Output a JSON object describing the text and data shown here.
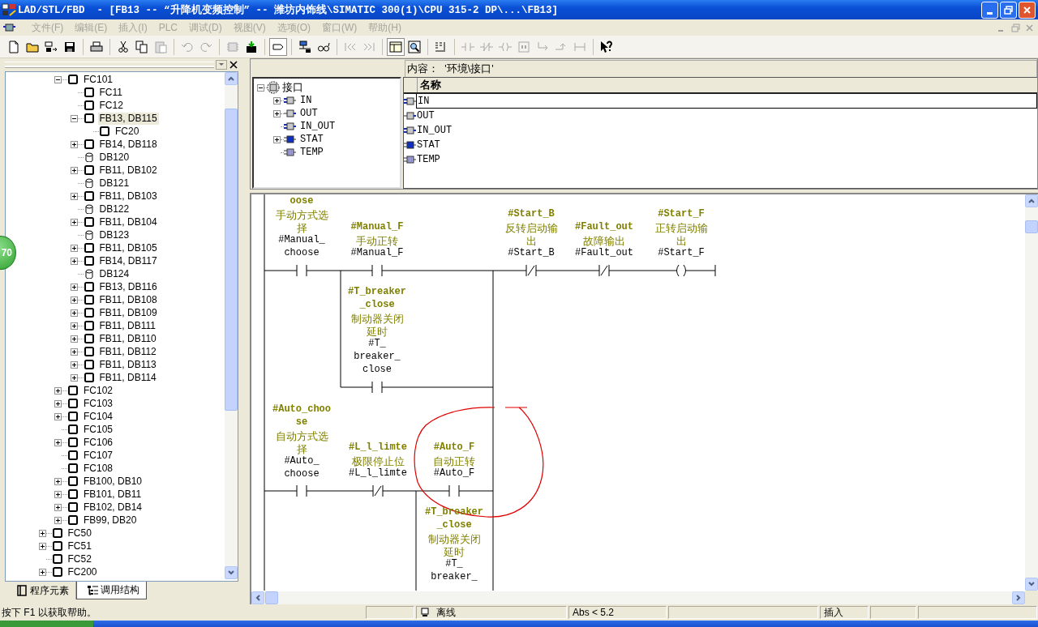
{
  "window": {
    "title": "LAD/STL/FBD  - [FB13 -- “升降机变频控制” -- 潍坊内饰线\\SIMATIC 300(1)\\CPU 315-2 DP\\...\\FB13]"
  },
  "menu": [
    {
      "label": "文件(F)",
      "disabled": true
    },
    {
      "label": "编辑(E)",
      "disabled": true
    },
    {
      "label": "插入(I)",
      "disabled": true
    },
    {
      "label": "PLC",
      "disabled": true
    },
    {
      "label": "调试(D)",
      "disabled": true
    },
    {
      "label": "视图(V)",
      "disabled": true
    },
    {
      "label": "选项(O)",
      "disabled": true
    },
    {
      "label": "窗口(W)",
      "disabled": true
    },
    {
      "label": "帮助(H)",
      "disabled": true
    }
  ],
  "toolbar": {
    "groups": [
      {
        "buttons": [
          {
            "kind": "new",
            "disabled": false,
            "pressed": false
          },
          {
            "kind": "open",
            "disabled": false,
            "pressed": false
          },
          {
            "kind": "nodes",
            "disabled": false,
            "pressed": false
          },
          {
            "kind": "save",
            "disabled": false,
            "pressed": false
          }
        ]
      },
      {
        "buttons": [
          {
            "kind": "print",
            "disabled": false,
            "pressed": false
          }
        ]
      },
      {
        "buttons": [
          {
            "kind": "cut",
            "disabled": false,
            "pressed": false
          },
          {
            "kind": "copy",
            "disabled": false,
            "pressed": false
          },
          {
            "kind": "paste",
            "disabled": true,
            "pressed": false
          }
        ]
      },
      {
        "buttons": [
          {
            "kind": "undo",
            "disabled": true,
            "pressed": false
          },
          {
            "kind": "redo",
            "disabled": true,
            "pressed": false
          }
        ]
      },
      {
        "buttons": [
          {
            "kind": "module",
            "disabled": true,
            "pressed": false
          },
          {
            "kind": "download",
            "disabled": false,
            "pressed": false
          }
        ]
      },
      {
        "buttons": [
          {
            "kind": "tag",
            "disabled": false,
            "pressed": true
          }
        ]
      },
      {
        "buttons": [
          {
            "kind": "network",
            "disabled": false,
            "pressed": false
          },
          {
            "kind": "glasses",
            "disabled": false,
            "pressed": false
          }
        ]
      },
      {
        "buttons": [
          {
            "kind": "previous",
            "disabled": true,
            "pressed": false
          },
          {
            "kind": "next",
            "disabled": true,
            "pressed": false
          }
        ]
      },
      {
        "buttons": [
          {
            "kind": "overview",
            "disabled": false,
            "pressed": true
          },
          {
            "kind": "zoom",
            "disabled": false,
            "pressed": false
          }
        ]
      },
      {
        "buttons": [
          {
            "kind": "rung",
            "disabled": false,
            "pressed": false
          }
        ]
      },
      {
        "buttons": [
          {
            "kind": "contact",
            "disabled": true,
            "pressed": false
          },
          {
            "kind": "nc_contact",
            "disabled": true,
            "pressed": false
          },
          {
            "kind": "coil",
            "disabled": true,
            "pressed": false
          },
          {
            "kind": "empty_box",
            "disabled": true,
            "pressed": false
          },
          {
            "kind": "branch_open",
            "disabled": true,
            "pressed": false
          },
          {
            "kind": "branch_close",
            "disabled": true,
            "pressed": false
          },
          {
            "kind": "connector",
            "disabled": true,
            "pressed": false
          }
        ]
      },
      {
        "buttons": [
          {
            "kind": "help",
            "disabled": false,
            "pressed": false
          }
        ]
      }
    ]
  },
  "floating_badge": {
    "text": "70"
  },
  "tree": {
    "items": [
      {
        "children": [
          {
            "label": "FC101",
            "kind": "block",
            "expanded": true,
            "selected": false,
            "children": [
              {
                "label": "FC11",
                "kind": "block",
                "selected": false
              },
              {
                "label": "FC12",
                "kind": "block",
                "selected": false
              },
              {
                "label": "FB13, DB115",
                "kind": "block",
                "expanded": true,
                "selected": true,
                "children": [
                  {
                    "label": "FC20",
                    "kind": "block",
                    "selected": false
                  }
                ]
              },
              {
                "label": "FB14, DB118",
                "kind": "block",
                "expanded": false,
                "selected": false
              },
              {
                "label": "DB120",
                "kind": "db",
                "selected": false
              },
              {
                "label": "FB11, DB102",
                "kind": "block",
                "expanded": false,
                "selected": false
              },
              {
                "label": "DB121",
                "kind": "db",
                "selected": false
              },
              {
                "label": "FB11, DB103",
                "kind": "block",
                "expanded": false,
                "selected": false
              },
              {
                "label": "DB122",
                "kind": "db",
                "selected": false
              },
              {
                "label": "FB11, DB104",
                "kind": "block",
                "expanded": false,
                "selected": false
              },
              {
                "label": "DB123",
                "kind": "db",
                "selected": false
              },
              {
                "label": "FB11, DB105",
                "kind": "block",
                "expanded": false,
                "selected": false
              },
              {
                "label": "FB14, DB117",
                "kind": "block",
                "expanded": false,
                "selected": false
              },
              {
                "label": "DB124",
                "kind": "db",
                "selected": false
              },
              {
                "label": "FB13, DB116",
                "kind": "block",
                "expanded": false,
                "selected": false
              },
              {
                "label": "FB11, DB108",
                "kind": "block",
                "expanded": false,
                "selected": false
              },
              {
                "label": "FB11, DB109",
                "kind": "block",
                "expanded": false,
                "selected": false
              },
              {
                "label": "FB11, DB111",
                "kind": "block",
                "expanded": false,
                "selected": false
              },
              {
                "label": "FB11, DB110",
                "kind": "block",
                "expanded": false,
                "selected": false
              },
              {
                "label": "FB11, DB112",
                "kind": "block",
                "expanded": false,
                "selected": false
              },
              {
                "label": "FB11, DB113",
                "kind": "block",
                "expanded": false,
                "selected": false
              },
              {
                "label": "FB11, DB114",
                "kind": "block",
                "expanded": false,
                "selected": false
              }
            ]
          },
          {
            "label": "FC102",
            "kind": "block",
            "expanded": false,
            "selected": false
          },
          {
            "label": "FC103",
            "kind": "block",
            "expanded": false,
            "selected": false
          },
          {
            "label": "FC104",
            "kind": "block",
            "expanded": false,
            "selected": false
          },
          {
            "label": "FC105",
            "kind": "block",
            "selected": false
          },
          {
            "label": "FC106",
            "kind": "block",
            "expanded": false,
            "selected": false
          },
          {
            "label": "FC107",
            "kind": "block",
            "selected": false
          },
          {
            "label": "FC108",
            "kind": "block",
            "selected": false
          },
          {
            "label": "FB100, DB10",
            "kind": "block",
            "expanded": false,
            "selected": false
          },
          {
            "label": "FB101, DB11",
            "kind": "block",
            "expanded": false,
            "selected": false
          },
          {
            "label": "FB102, DB14",
            "kind": "block",
            "expanded": false,
            "selected": false
          },
          {
            "label": "FB99, DB20",
            "kind": "block",
            "expanded": false,
            "selected": false
          }
        ]
      },
      {
        "label": "FC50",
        "kind": "block",
        "expanded": false,
        "selected": false
      },
      {
        "label": "FC51",
        "kind": "block",
        "expanded": false,
        "selected": false
      },
      {
        "label": "FC52",
        "kind": "block",
        "selected": false
      },
      {
        "label": "FC200",
        "kind": "block",
        "expanded": false,
        "selected": false
      }
    ]
  },
  "tabs": [
    {
      "label": "程序元素",
      "selected": false
    },
    {
      "label": "调用结构",
      "selected": true
    }
  ],
  "interface": {
    "content_path": "内容：  '环境\\接口'",
    "tree": {
      "label": "接口",
      "expanded": true,
      "children": [
        {
          "label": "IN",
          "kind": "in",
          "expanded": false
        },
        {
          "label": "OUT",
          "kind": "out",
          "expanded": false
        },
        {
          "label": "IN_OUT",
          "kind": "in_out"
        },
        {
          "label": "STAT",
          "kind": "stat",
          "expanded": false
        },
        {
          "label": "TEMP",
          "kind": "temp"
        }
      ]
    },
    "column": "名称",
    "rows": [
      {
        "label": "IN",
        "kind": "in",
        "selected": true
      },
      {
        "label": "OUT",
        "kind": "out",
        "selected": false
      },
      {
        "label": "IN_OUT",
        "kind": "in_out",
        "selected": false
      },
      {
        "label": "STAT",
        "kind": "stat",
        "selected": false
      },
      {
        "label": "TEMP",
        "kind": "temp",
        "selected": false
      }
    ]
  },
  "ladder": {
    "networks": [
      {
        "elements": [
          {
            "kind": "no",
            "symbol": [
              "oose"
            ],
            "comment": [
              "手动方式选",
              "择"
            ],
            "operand": [
              "#Manual_",
              "choose"
            ]
          },
          {
            "kind": "no",
            "symbol": [
              "#Manual_F"
            ],
            "comment": [
              "手动正转"
            ],
            "operand": [
              "#Manual_F"
            ]
          },
          {
            "kind": "no",
            "symbol": [
              "#T_breaker",
              "_close"
            ],
            "comment": [
              "制动器关闭",
              "延时"
            ],
            "operand": [
              "#T_",
              "breaker_",
              "close"
            ]
          },
          {
            "kind": "nc",
            "symbol": [
              "#Start_B"
            ],
            "comment": [
              "反转启动输",
              "出"
            ],
            "operand": [
              "#Start_B"
            ]
          },
          {
            "kind": "nc",
            "symbol": [
              "#Fault_out"
            ],
            "comment": [
              "故障输出"
            ],
            "operand": [
              "#Fault_out"
            ]
          },
          {
            "kind": "coil",
            "symbol": [
              "#Start_F"
            ],
            "comment": [
              "正转启动输",
              "出"
            ],
            "operand": [
              "#Start_F"
            ]
          }
        ]
      },
      {
        "elements": [
          {
            "kind": "no",
            "symbol": [
              "#Auto_choo",
              "se"
            ],
            "comment": [
              "自动方式选",
              "择"
            ],
            "operand": [
              "#Auto_",
              "choose"
            ]
          },
          {
            "kind": "nc",
            "symbol": [
              "#L_l_limte"
            ],
            "comment": [
              "极限停止位"
            ],
            "operand": [
              "#L_l_limte"
            ]
          },
          {
            "kind": "no",
            "symbol": [
              "#Auto_F"
            ],
            "comment": [
              "自动正转"
            ],
            "operand": [
              "#Auto_F"
            ]
          },
          {
            "symbol": [
              "#T_breaker",
              "_close"
            ],
            "comment": [
              "制动器关闭",
              "延时"
            ],
            "operand": [
              "#T_",
              "breaker_"
            ]
          }
        ]
      }
    ]
  },
  "status_bar": {
    "help": "按下 F1 以获取帮助。",
    "mode": "离线",
    "version": "Abs < 5.2",
    "insert": "插入"
  }
}
